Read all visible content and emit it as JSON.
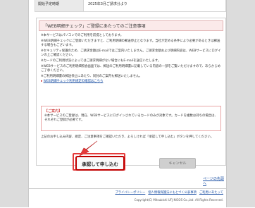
{
  "start_row": {
    "label": "開始予定時期",
    "value": "2025年3月ご請求分より"
  },
  "box_title": "「WEB明細チェック」ご登録にあたってのご注意事項",
  "notes": [
    "※本サービスはパソコンでのご利用を前提としております。",
    "※WEB明細チェックにご登録いただきますと、ご利用明細の郵送停止となります。当社が定める条件により必要があるときは郵送する場合もございます。",
    "※セキュリティ保護のため、ご請求金額はE-mailではご案内いたしません。ご請求金額および明細内容は、WEBサービスにログインの上ご確認ください。",
    "※カードのご利用状況によってはご請求明細がない場合にもE-mailを送信いたします。",
    "※WEBサービスのご利用明細照会画面では、郵送のご利用明細書に記載している内容の一部をご覧いただけますので、あらかじめご了承ください。",
    "※ご利用明細書の郵送停止にあたり、同封のご案内も郵送いたしません。"
  ],
  "terms_link": "WEB明細チェック利用規定の確認はこちら",
  "notice": {
    "heading": "【ご案内】",
    "text": "※本サービスのご登録は、現在、WEBサービスにログインされているカードのみが対象です。カードを複数お持ちの場合は、それぞれご登録が必要です。"
  },
  "final_text": "上記のお申し込み内容、規定、ご注意事項をご確認いただき、よろしければ「承認して申し込む」ボタンを押してください。",
  "buttons": {
    "agree": "承認して申し込む",
    "cancel": "キャンセル"
  },
  "page_top": "ページの先頭へ",
  "footer": {
    "links": [
      "プライバシーポリシー",
      "個人情報保護法にもとづく公表事項",
      "ご利用にあたって"
    ],
    "copyright": "Copyright(C) Mitsubishi UFJ NICOS Co.,Ltd. All Rights Reserved."
  },
  "colors": {
    "accent": "#c00000",
    "link": "#1a4fa3",
    "sidebar": "#dcdcdc"
  }
}
